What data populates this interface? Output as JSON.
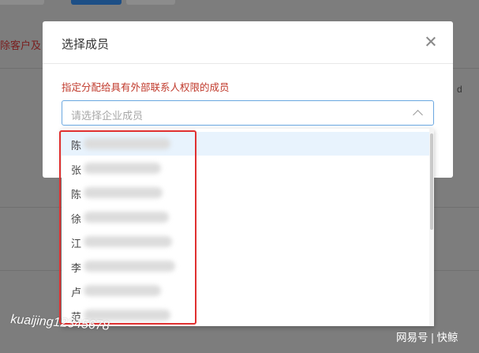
{
  "background": {
    "partial_text": "除客户及",
    "right_char": "d"
  },
  "modal": {
    "title": "选择成员",
    "hint": "指定分配给具有外部联系人权限的成员",
    "select": {
      "placeholder": "请选择企业成员"
    }
  },
  "dropdown": {
    "items": [
      {
        "surname": "陈"
      },
      {
        "surname": "张"
      },
      {
        "surname": "陈"
      },
      {
        "surname": "徐"
      },
      {
        "surname": "江"
      },
      {
        "surname": "李"
      },
      {
        "surname": "卢"
      },
      {
        "surname": "范"
      }
    ]
  },
  "watermarks": {
    "left": "kuaijing12345678",
    "right": "网易号 | 快鲸"
  },
  "colors": {
    "hint": "#c0392b",
    "select_border": "#6aa7e0",
    "selected_row": "#e8f3fd",
    "highlight_frame": "#e03030"
  }
}
